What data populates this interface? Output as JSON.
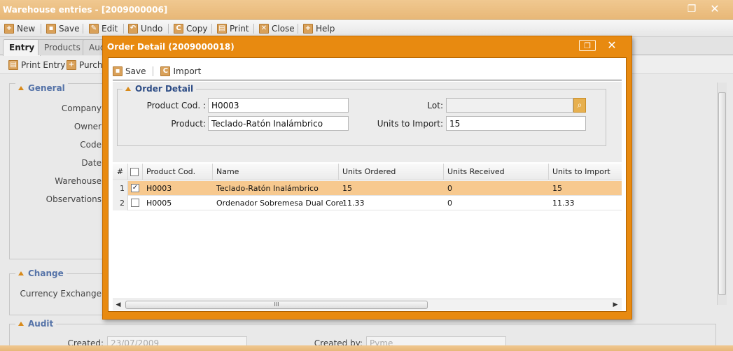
{
  "background": {
    "title": "Warehouse entries - [2009000006]",
    "toolbar": {
      "new": "New",
      "save": "Save",
      "edit": "Edit",
      "undo": "Undo",
      "copy": "Copy",
      "print": "Print",
      "close": "Close",
      "help": "Help"
    },
    "tabs": [
      "Entry",
      "Products",
      "Aud"
    ],
    "subtoolbar": {
      "print_entry": "Print Entry",
      "purchase": "Purcha"
    },
    "sections": {
      "general": "General",
      "change": "Change",
      "audit": "Audit"
    },
    "fields": {
      "company": "Company",
      "owner": "Owner",
      "code": "Code",
      "date": "Date",
      "warehouse": "Warehouse",
      "observations": "Observations",
      "currency_exchange": "Currency Exchange",
      "created": "Created:",
      "created_value": "23/07/2009",
      "created_by": "Created by:",
      "created_by_value": "Pyme"
    }
  },
  "modal": {
    "title": "Order Detail (2009000018)",
    "toolbar": {
      "save": "Save",
      "import": "Import"
    },
    "form": {
      "legend": "Order Detail",
      "product_code_label": "Product Cod. :",
      "product_code_value": "H0003",
      "product_label": "Product:",
      "product_value": "Teclado-Ratón Inalámbrico",
      "lot_label": "Lot:",
      "lot_value": "",
      "units_to_import_label": "Units to Import:",
      "units_to_import_value": "15"
    },
    "grid": {
      "columns": [
        "#",
        "Product Cod.",
        "Name",
        "Units Ordered",
        "Units Received",
        "Units to Import"
      ],
      "rows": [
        {
          "num": "1",
          "checked": true,
          "code": "H0003",
          "name": "Teclado-Ratón Inalámbrico",
          "ordered": "15",
          "received": "0",
          "to_import": "15"
        },
        {
          "num": "2",
          "checked": false,
          "code": "H0005",
          "name": "Ordenador Sobremesa Dual Core",
          "ordered": "11.33",
          "received": "0",
          "to_import": "11.33"
        }
      ]
    }
  },
  "colors": {
    "accent": "#e88a10",
    "selected_row": "#f7c98f",
    "legend_blue": "#2e4d86"
  }
}
